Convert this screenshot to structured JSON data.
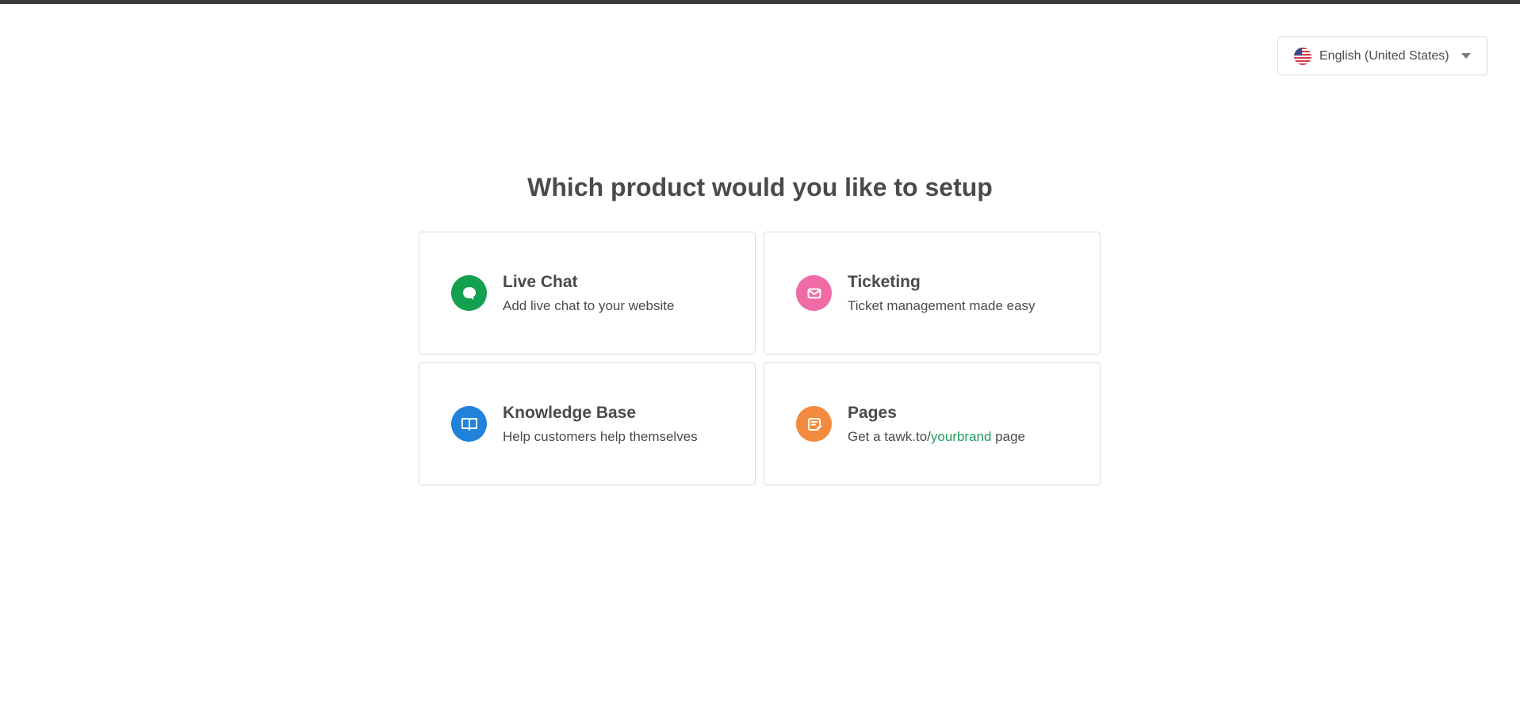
{
  "header": {
    "language": {
      "label": "English (United States)",
      "flag": "us-flag-icon"
    }
  },
  "main": {
    "title": "Which product would you like to setup",
    "products": [
      {
        "title": "Live Chat",
        "description": "Add live chat to your website",
        "icon": "chat-bubble-icon",
        "color": "#13a14f"
      },
      {
        "title": "Ticketing",
        "description": "Ticket management made easy",
        "icon": "envelope-icon",
        "color": "#f06aa6"
      },
      {
        "title": "Knowledge Base",
        "description": "Help customers help themselves",
        "icon": "book-icon",
        "color": "#1f82db"
      },
      {
        "title": "Pages",
        "description_prefix": "Get a tawk.to/",
        "description_accent": "yourbrand",
        "description_suffix": " page",
        "icon": "page-edit-icon",
        "color": "#f28b3f"
      }
    ]
  },
  "colors": {
    "top_bar": "#3a3a3a",
    "accent_text": "#1e9e5a"
  }
}
